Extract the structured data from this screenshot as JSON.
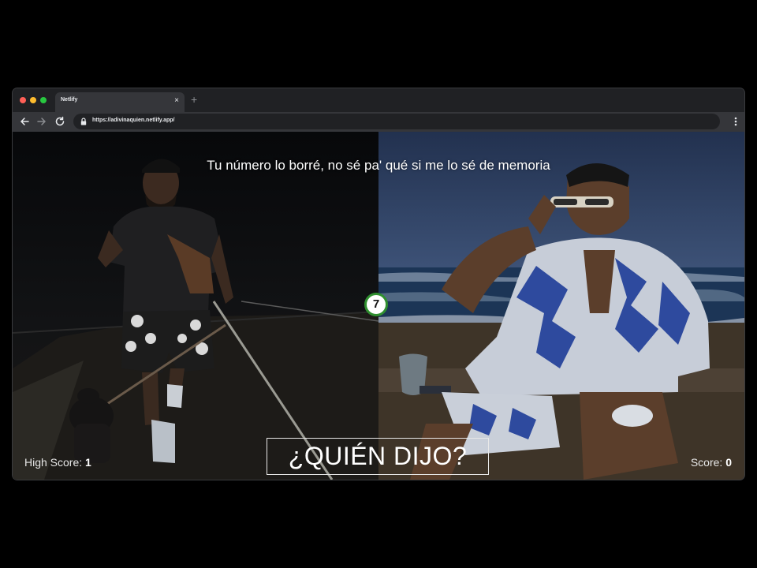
{
  "browser": {
    "tab_title": "Netlify",
    "tab_close": "×",
    "new_tab": "+",
    "url": "https://adivinaquien.netlify.app/"
  },
  "icons": {
    "back": "arrow-left-icon",
    "forward": "arrow-right-icon",
    "reload": "reload-icon",
    "lock": "lock-icon",
    "menu": "vertical-dots-icon",
    "close": "close-icon"
  },
  "game": {
    "lyric": "Tu número lo borré, no sé pa' qué si me lo sé de memoria",
    "timer": "7",
    "title": "¿QUIÉN DIJO?",
    "high_score_label": "High Score:",
    "high_score_value": "1",
    "score_label": "Score:",
    "score_value": "0"
  },
  "colors": {
    "timer_ring": "#2f8f2f",
    "window_chrome": "#202124",
    "toolbar": "#35363a"
  }
}
